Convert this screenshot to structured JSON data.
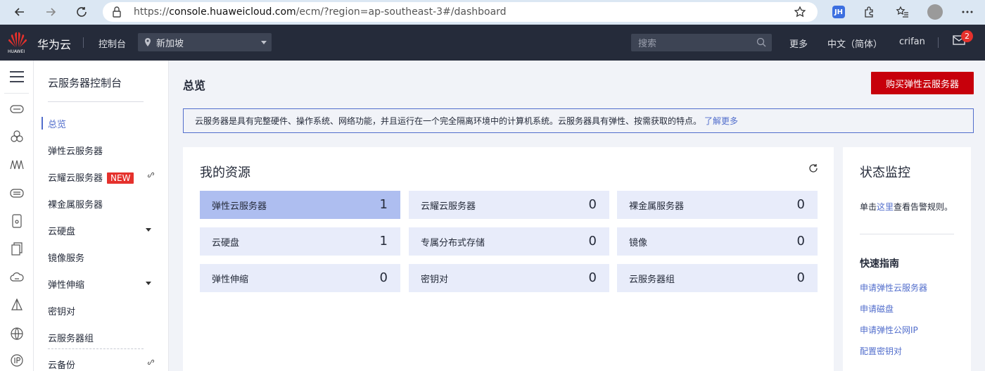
{
  "browser": {
    "url_prefix": "https://",
    "url_host": "console.huaweicloud.com",
    "url_path": "/ecm/?region=ap-southeast-3#/dashboard",
    "ext_jh": "JH"
  },
  "topbar": {
    "logo_text": "HUAWEI",
    "brand": "华为云",
    "console": "控制台",
    "region": "新加坡",
    "search_placeholder": "搜索",
    "more": "更多",
    "language": "中文（简体）",
    "user": "crifan",
    "mail_count": "2"
  },
  "sidebar": {
    "title": "云服务器控制台",
    "items": [
      {
        "label": "总览"
      },
      {
        "label": "弹性云服务器"
      },
      {
        "label": "云耀云服务器",
        "badge": "NEW"
      },
      {
        "label": "裸金属服务器"
      },
      {
        "label": "云硬盘"
      },
      {
        "label": "镜像服务"
      },
      {
        "label": "弹性伸缩"
      },
      {
        "label": "密钥对"
      },
      {
        "label": "云服务器组"
      },
      {
        "label": "云备份"
      }
    ]
  },
  "main": {
    "title": "总览",
    "buy_button": "购买弹性云服务器",
    "notice": "云服务器是具有完整硬件、操作系统、网络功能，并且运行在一个完全隔离环境中的计算机系统。云服务器具有弹性、按需获取的特点。",
    "notice_link": "了解更多",
    "resources_title": "我的资源",
    "tiles": [
      {
        "label": "弹性云服务器",
        "count": "1"
      },
      {
        "label": "云耀云服务器",
        "count": "0"
      },
      {
        "label": "裸金属服务器",
        "count": "0"
      },
      {
        "label": "云硬盘",
        "count": "1"
      },
      {
        "label": "专属分布式存储",
        "count": "0"
      },
      {
        "label": "镜像",
        "count": "0"
      },
      {
        "label": "弹性伸缩",
        "count": "0"
      },
      {
        "label": "密钥对",
        "count": "0"
      },
      {
        "label": "云服务器组",
        "count": "0"
      }
    ]
  },
  "monitor": {
    "title": "状态监控",
    "text_before": "单击",
    "text_link": "这里",
    "text_after": "查看告警规则。",
    "guide_title": "快速指南",
    "guides": [
      "申请弹性云服务器",
      "申请磁盘",
      "申请弹性公网IP",
      "配置密钥对"
    ]
  },
  "colors": {
    "brand_red": "#c7000b",
    "accent_blue": "#526ecc",
    "topbar_bg": "#252b3a"
  }
}
